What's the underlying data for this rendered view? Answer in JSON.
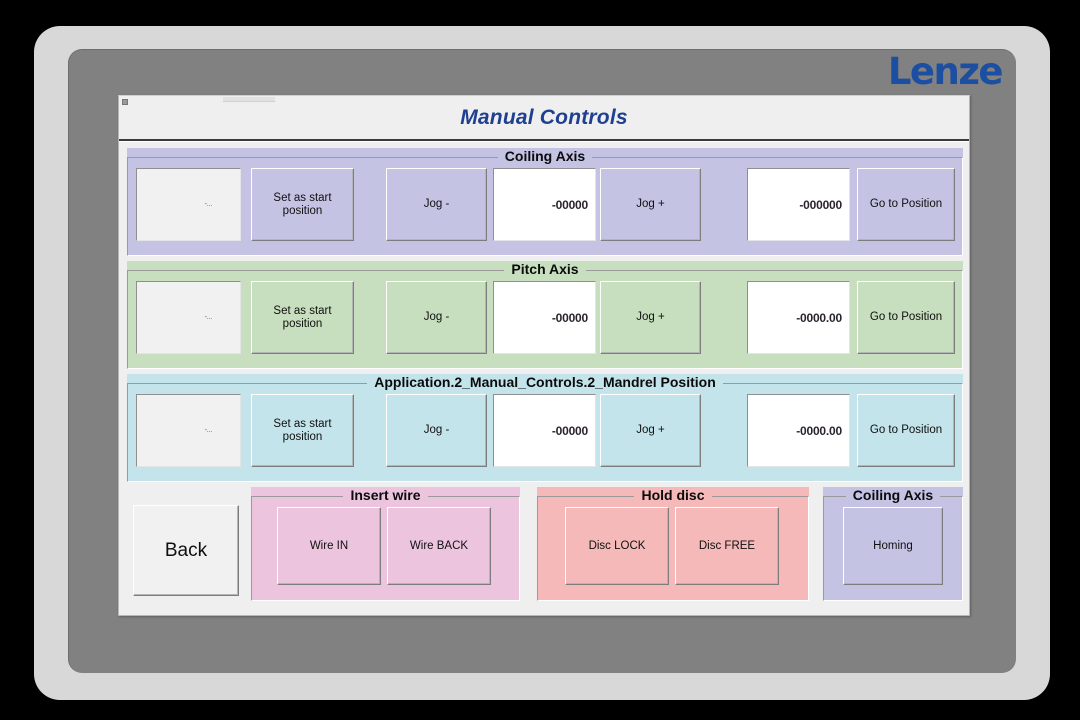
{
  "brand": {
    "logo_text": "Lenze",
    "logo_color": "#1c4fa1"
  },
  "window": {
    "title": "Manual Controls",
    "title_color": "#1f3f91"
  },
  "axis_sections": [
    {
      "key": "coiling",
      "title": "Coiling Axis",
      "accent": "#c4c3e4",
      "readout": "-...",
      "set_start_label": "Set as start\nposition",
      "set_start_line1": "Set as start",
      "set_start_line2": "position",
      "jog_minus_label": "Jog -",
      "jog_value": "-00000",
      "jog_plus_label": "Jog +",
      "target_value": "-000000",
      "go_to_position_label": "Go to Position"
    },
    {
      "key": "pitch",
      "title": "Pitch Axis",
      "accent": "#c7dfbf",
      "readout": "-...",
      "set_start_line1": "Set as start",
      "set_start_line2": "position",
      "jog_minus_label": "Jog -",
      "jog_value": "-00000",
      "jog_plus_label": "Jog +",
      "target_value": "-0000.00",
      "go_to_position_label": "Go to Position"
    },
    {
      "key": "mandrel",
      "title": "Application.2_Manual_Controls.2_Mandrel Position",
      "accent": "#c4e4ec",
      "readout": "-...",
      "set_start_line1": "Set as start",
      "set_start_line2": "position",
      "jog_minus_label": "Jog -",
      "jog_value": "-00000",
      "jog_plus_label": "Jog +",
      "target_value": "-0000.00",
      "go_to_position_label": "Go to Position"
    }
  ],
  "footer": {
    "back_label": "Back",
    "insert_wire": {
      "title": "Insert wire",
      "accent": "#ecc4de",
      "buttons": [
        {
          "label": "Wire IN"
        },
        {
          "label": "Wire BACK"
        }
      ]
    },
    "hold_disc": {
      "title": "Hold disc",
      "accent": "#f5b9b9",
      "buttons": [
        {
          "label": "Disc LOCK"
        },
        {
          "label": "Disc FREE"
        }
      ]
    },
    "homing": {
      "title": "Coiling Axis",
      "accent": "#c4c3e4",
      "buttons": [
        {
          "label": "Homing"
        }
      ]
    }
  }
}
